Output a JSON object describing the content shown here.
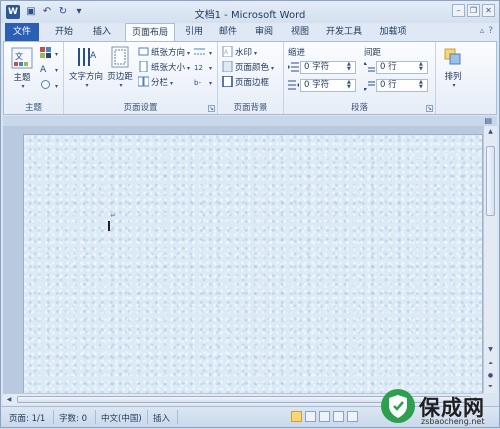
{
  "window": {
    "title": "文档1 - Microsoft Word",
    "app_icon": "W"
  },
  "quick_access": [
    "save-icon",
    "undo-icon",
    "redo-icon",
    "customize-icon"
  ],
  "tabs": [
    {
      "label": "文件"
    },
    {
      "label": "开始"
    },
    {
      "label": "插入"
    },
    {
      "label": "页面布局"
    },
    {
      "label": "引用"
    },
    {
      "label": "邮件"
    },
    {
      "label": "审阅"
    },
    {
      "label": "视图"
    },
    {
      "label": "开发工具"
    },
    {
      "label": "加载项"
    }
  ],
  "active_tab": "页面布局",
  "ribbon": {
    "themes": {
      "group_label": "主题",
      "theme_btn": "主题"
    },
    "page_setup": {
      "group_label": "页面设置",
      "text_direction": "文字方向",
      "margins": "页边距",
      "orientation": "纸张方向",
      "size": "纸张大小",
      "columns": "分栏"
    },
    "page_background": {
      "group_label": "页面背景",
      "watermark": "水印",
      "page_color": "页面颜色",
      "page_borders": "页面边框"
    },
    "paragraph": {
      "group_label": "段落",
      "indent_label": "缩进",
      "spacing_label": "间距",
      "indent_left": "0 字符",
      "indent_right": "0 字符",
      "spacing_before": "0 行",
      "spacing_after": "0 行"
    },
    "arrange": {
      "group_label": "",
      "arrange_btn": "排列"
    }
  },
  "document": {
    "paragraph_mark": "↵"
  },
  "status_bar": {
    "page": "页面: 1/1",
    "words": "字数: 0",
    "language": "中文(中国)",
    "mode": "插入"
  },
  "watermark": {
    "name": "保成网",
    "url": "zsbaocheng.net"
  }
}
